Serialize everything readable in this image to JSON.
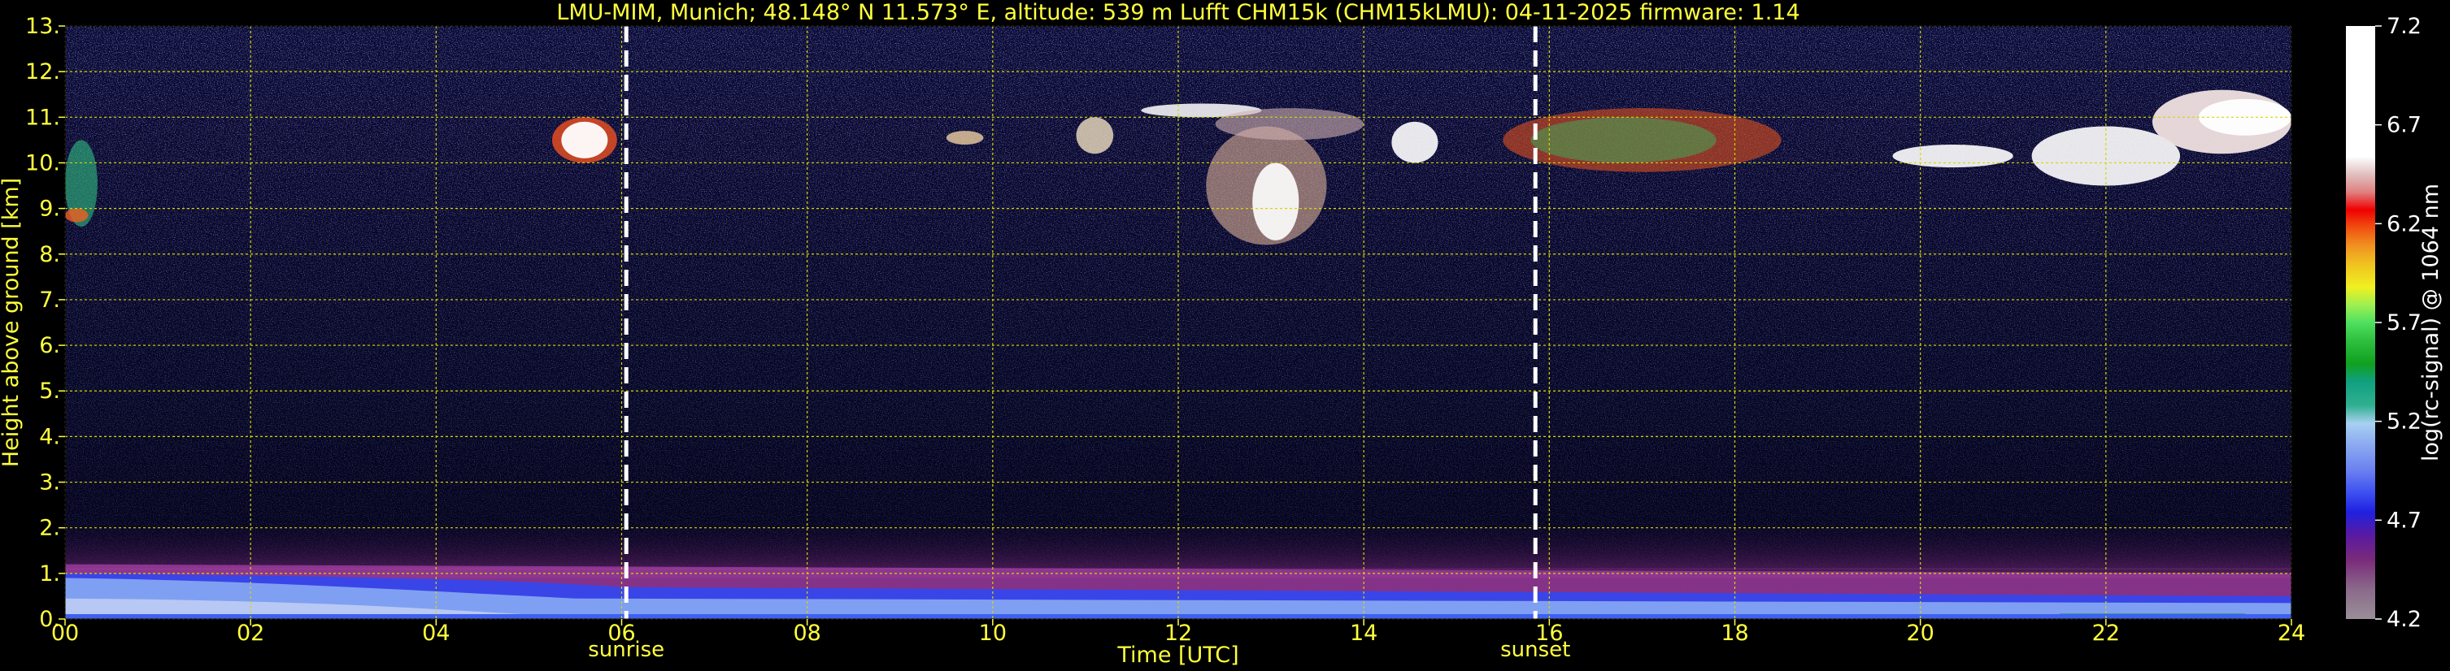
{
  "chart_data": {
    "type": "heatmap",
    "title": "LMU-MIM, Munich; 48.148° N 11.573° E, altitude: 539 m    Lufft CHM15k (CHM15kLMU): 04-11-2025    firmware: 1.14",
    "xlabel": "Time [UTC]",
    "ylabel": "Height above ground [km]",
    "xlim": [
      0,
      24
    ],
    "ylim": [
      0,
      13
    ],
    "x_ticks": [
      "00",
      "02",
      "04",
      "06",
      "08",
      "10",
      "12",
      "14",
      "16",
      "18",
      "20",
      "22",
      "24"
    ],
    "y_ticks": [
      "0.",
      "1.",
      "2.",
      "3.",
      "4.",
      "5.",
      "6.",
      "7.",
      "8.",
      "9.",
      "10.",
      "11.",
      "12.",
      "13."
    ],
    "grid": true,
    "events": [
      {
        "label": "sunrise",
        "time": 6.05
      },
      {
        "label": "sunset",
        "time": 15.85
      }
    ],
    "colorbar": {
      "label": "log(rc-signal) @ 1064 nm",
      "range": [
        4.2,
        7.2
      ],
      "ticks": [
        "4.2",
        "4.7",
        "5.2",
        "5.7",
        "6.2",
        "6.7",
        "7.2"
      ]
    },
    "features": [
      {
        "name": "boundary layer",
        "time_range": [
          0,
          24
        ],
        "height_range_km": [
          0,
          1.1
        ]
      },
      {
        "name": "cirrus cloud",
        "time_range": [
          5.2,
          6.0
        ],
        "height_range_km": [
          10.0,
          11.0
        ]
      },
      {
        "name": "cirrus cloud",
        "time_range": [
          12.3,
          13.6
        ],
        "height_range_km": [
          8.2,
          11.2
        ]
      },
      {
        "name": "cirrus cloud",
        "time_range": [
          14.3,
          24
        ],
        "height_range_km": [
          9.5,
          11.6
        ]
      }
    ]
  },
  "colors": {
    "text": "#ffff3c",
    "grid": "#d6d600",
    "background": "#000000"
  }
}
